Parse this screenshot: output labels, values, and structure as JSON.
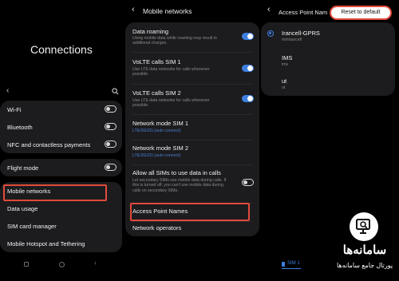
{
  "panel1": {
    "title": "Connections",
    "items_group1": [
      {
        "label": "Wi-Fi"
      },
      {
        "label": "Bluetooth"
      },
      {
        "label": "NFC and contactless payments"
      }
    ],
    "items_group2": [
      {
        "label": "Flight mode"
      }
    ],
    "items_group3": [
      {
        "label": "Mobile networks"
      },
      {
        "label": "Data usage"
      },
      {
        "label": "SIM card manager"
      },
      {
        "label": "Mobile Hotspot and Tethering"
      }
    ]
  },
  "panel2": {
    "title": "Mobile networks",
    "items": [
      {
        "label": "Data roaming",
        "sub": "Using mobile data while roaming may result in additional charges.",
        "toggle": "on"
      },
      {
        "label": "VoLTE calls SIM 1",
        "sub": "Use LTE data networks for calls whenever possible.",
        "toggle": "on"
      },
      {
        "label": "VoLTE calls SIM 2",
        "sub": "Use LTE data networks for calls whenever possible.",
        "toggle": "on"
      },
      {
        "label": "Network mode SIM 1",
        "sub": "LTE/3G/2G (auto connect)"
      },
      {
        "label": "Network mode SIM 2",
        "sub": "LTE/3G/2G (auto connect)"
      },
      {
        "label": "Allow all SIMs to use data in calls",
        "sub": "Let secondary SIMs use mobile data during calls. If this is turned off, you can't use mobile data during calls on secondary SIMs.",
        "toggle": "off"
      },
      {
        "label": "Access Point Names"
      },
      {
        "label": "Network operators"
      }
    ]
  },
  "panel3": {
    "title": "Access Point Nam",
    "reset_label": "Reset to default",
    "apns": [
      {
        "name": "Irancell-GPRS",
        "apn": "mtnirancell",
        "selected": true
      },
      {
        "name": "IMS",
        "apn": "ims",
        "selected": false
      },
      {
        "name": "ut",
        "apn": "ut",
        "selected": false
      }
    ],
    "sim_tab": "SIM 1"
  },
  "watermark": {
    "line1": "سامانه‌ها",
    "line2": "پورتال جامع سامانه‌ها"
  },
  "colors": {
    "accent": "#3d7ee0",
    "highlight": "#e24a3b",
    "card": "#1c1c1e"
  }
}
